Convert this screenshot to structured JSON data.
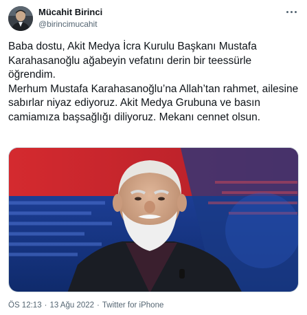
{
  "author": {
    "display_name": "Mücahit Birinci",
    "handle": "@birincimucahit"
  },
  "tweet": {
    "text": "Baba dostu, Akit Medya İcra Kurulu Başkanı Mustafa Karahasanoğlu ağabeyin vefatını derin bir teessürle öğrendim.\nMerhum Mustafa Karahasanoğlu’na Allah’tan rahmet, ailesine sabırlar niyaz ediyoruz. Akit Medya Grubuna ve basın camiamıza başsağlığı diliyoruz. Mekanı cennet olsun."
  },
  "meta": {
    "time": "ÖS 12:13",
    "separator": "·",
    "date": "13 Ağu 2022",
    "source": "Twitter for iPhone"
  },
  "colors": {
    "text": "#0f1419",
    "secondary": "#536471",
    "media_background_red": "#c8232c",
    "media_background_blue": "#1b3d8f"
  },
  "icons": {
    "more": "more-icon",
    "avatar": "avatar"
  }
}
